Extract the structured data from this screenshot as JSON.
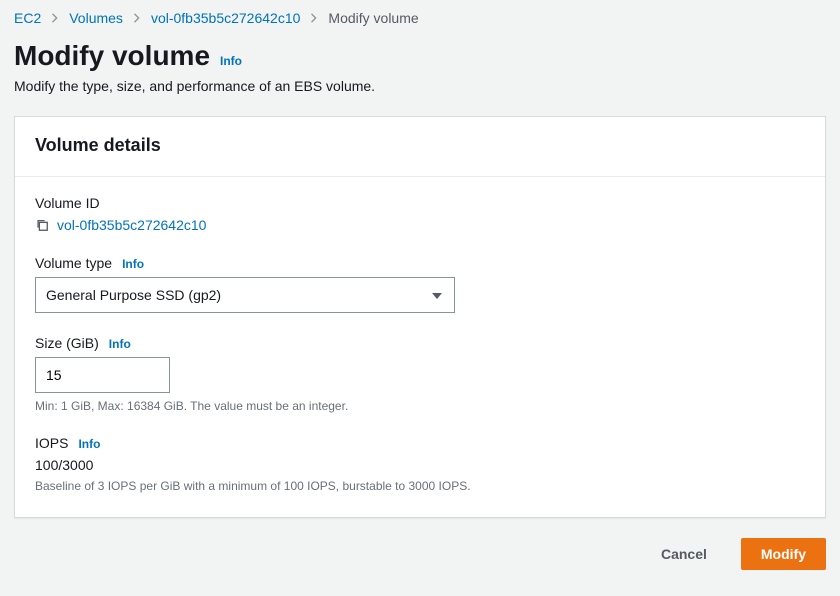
{
  "breadcrumb": {
    "items": [
      {
        "label": "EC2"
      },
      {
        "label": "Volumes"
      },
      {
        "label": "vol-0fb35b5c272642c10"
      }
    ],
    "current": "Modify volume"
  },
  "heading": {
    "title": "Modify volume",
    "info": "Info"
  },
  "description": "Modify the type, size, and performance of an EBS volume.",
  "panel": {
    "title": "Volume details"
  },
  "fields": {
    "volumeId": {
      "label": "Volume ID",
      "value": "vol-0fb35b5c272642c10"
    },
    "volumeType": {
      "label": "Volume type",
      "info": "Info",
      "selected": "General Purpose SSD (gp2)"
    },
    "size": {
      "label": "Size (GiB)",
      "info": "Info",
      "value": "15",
      "hint": "Min: 1 GiB, Max: 16384 GiB. The value must be an integer."
    },
    "iops": {
      "label": "IOPS",
      "info": "Info",
      "value": "100/3000",
      "hint": "Baseline of 3 IOPS per GiB with a minimum of 100 IOPS, burstable to 3000 IOPS."
    }
  },
  "actions": {
    "cancel": "Cancel",
    "modify": "Modify"
  }
}
